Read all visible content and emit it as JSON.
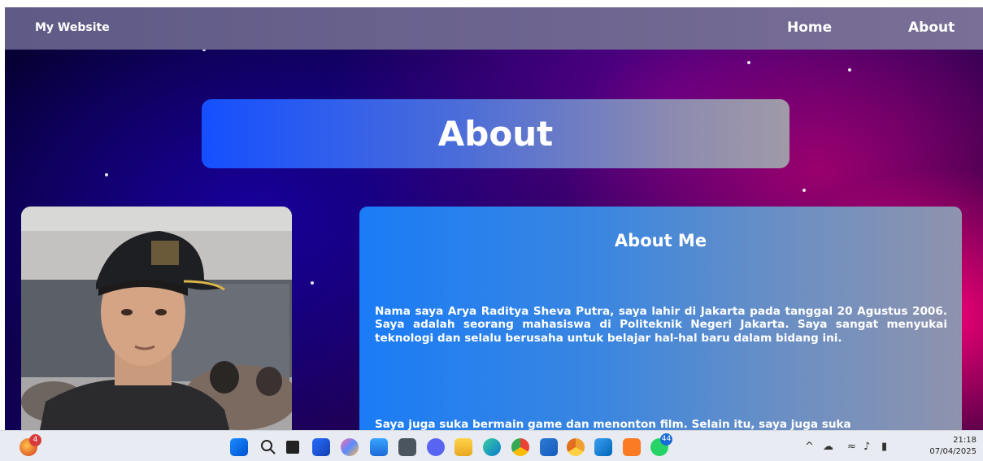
{
  "navbar": {
    "brand": "My Website",
    "links": [
      {
        "label": "Home"
      },
      {
        "label": "About"
      }
    ]
  },
  "hero": {
    "title": "About"
  },
  "about": {
    "heading": "About Me",
    "paragraphs": [
      "Nama saya Arya Raditya Sheva Putra, saya lahir di Jakarta pada tanggal 20 Agustus 2006. Saya adalah seorang mahasiswa di Politeknik Negeri Jakarta. Saya sangat menyukai teknologi dan selalu berusaha untuk belajar hal-hal baru dalam bidang ini.",
      "Saya juga suka bermain game dan menonton film. Selain itu, saya juga suka"
    ]
  },
  "taskbar": {
    "weather_badge": "4",
    "whatsapp_badge": "44",
    "icons": [
      "weather-icon",
      "start-icon",
      "search-icon",
      "task-view-icon",
      "store-icon",
      "copilot-icon",
      "notepad-icon",
      "calculator-icon",
      "discord-icon",
      "file-explorer-icon",
      "edge-icon",
      "chrome-icon",
      "word-icon",
      "chrome-canary-icon",
      "vscode-icon",
      "xampp-icon",
      "whatsapp-icon"
    ],
    "clock": {
      "time": "21:18",
      "date": "07/04/2025"
    }
  },
  "colors": {
    "navbar": "#6d6590",
    "hero_start": "#1550ff",
    "card_start": "#1a7cf6",
    "taskbar": "#e8ecf2"
  }
}
